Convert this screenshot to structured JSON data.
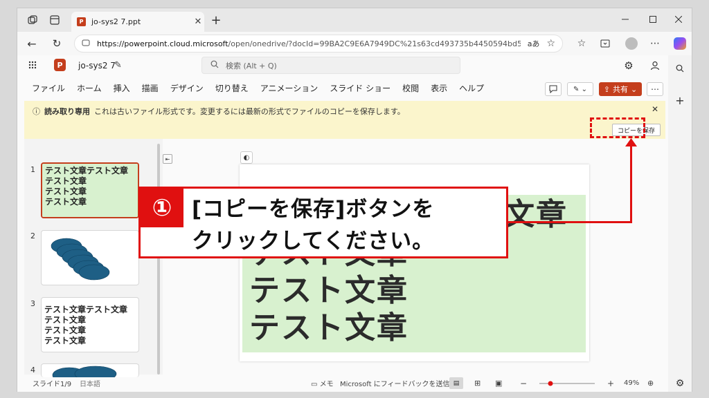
{
  "browser": {
    "tab_title": "jo-sys2 7.ppt",
    "tab_favicon": "P",
    "url_host": "https://powerpoint.cloud.microsoft",
    "url_rest": "/open/onedrive/?docId=99BA2C9E6A7949DC%21s63cd493735b4450594bd55bf7597...",
    "reader_icon": "aあ"
  },
  "app": {
    "logo": "P",
    "file_name": "jo-sys2 7",
    "search_placeholder": "検索 (Alt + Q)",
    "menu": [
      "ファイル",
      "ホーム",
      "挿入",
      "描画",
      "デザイン",
      "切り替え",
      "アニメーション",
      "スライド ショー",
      "校閲",
      "表示",
      "ヘルプ"
    ],
    "share_label": "共有",
    "notification": {
      "label": "読み取り専用",
      "message": "これは古いファイル形式です。変更するには最新の形式でファイルのコピーを保存します。",
      "save_copy_button": "コピーを保存"
    },
    "thumbnails": [
      {
        "num": "1",
        "lines": [
          "テスト文章テスト文章",
          "テスト文章",
          "テスト文章",
          "テスト文章"
        ]
      },
      {
        "num": "2"
      },
      {
        "num": "3",
        "lines": [
          "テスト文章テスト文章",
          "テスト文章",
          "テスト文章",
          "テスト文章"
        ]
      },
      {
        "num": "4"
      }
    ],
    "slide_lines": [
      "テスト文章テスト文章",
      "テスト文章",
      "テスト文章",
      "テスト文章"
    ],
    "status": {
      "slide_counter": "スライド1/9",
      "language": "日本語",
      "notes": "メモ",
      "feedback": "Microsoft にフィードバックを送信",
      "zoom": "49%",
      "zoom_level": 0.49
    }
  },
  "annotation": {
    "number": "①",
    "line1": "[コピーを保存]ボタンを",
    "line2": "クリックしてください。",
    "color": "#e01010"
  }
}
